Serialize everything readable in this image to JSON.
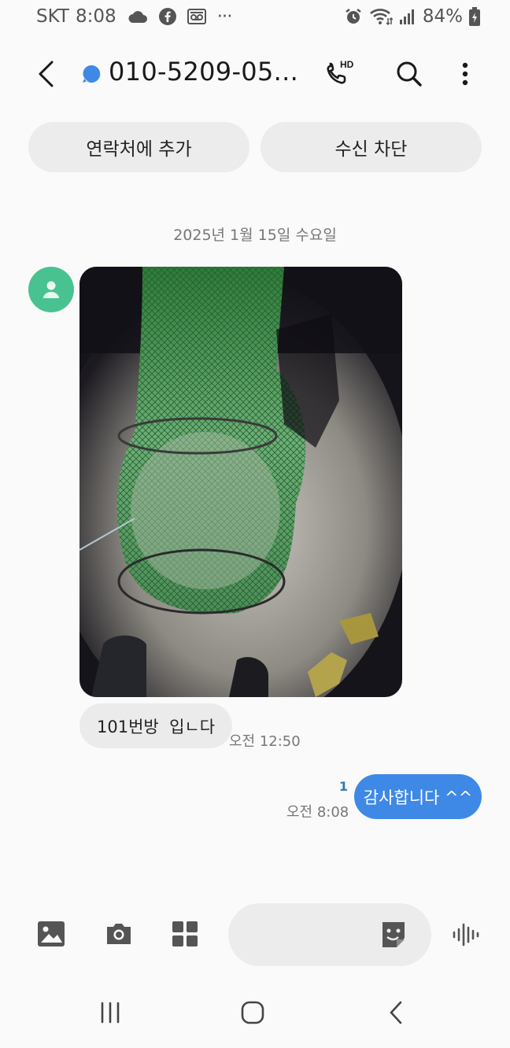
{
  "status_bar": {
    "carrier": "SKT",
    "time": "8:08",
    "more_indicator": "···",
    "battery": "84%",
    "icons_left": [
      "cloud-icon",
      "facebook-icon",
      "voicemail-icon"
    ],
    "icons_right": [
      "alarm-icon",
      "wifi-icon",
      "signal-icon",
      "battery-icon"
    ]
  },
  "header": {
    "title": "010-5209-05...",
    "hd_badge": "HD"
  },
  "actions": {
    "add_contact": "연락처에 추가",
    "block": "수신 차단"
  },
  "conversation": {
    "date": "2025년 1월 15일 수요일",
    "incoming": {
      "text": "101번방  입ㄴ다",
      "time": "오전 12:50"
    },
    "outgoing": {
      "text": "감사합니다 ^^",
      "time": "오전 8:08",
      "unread_count": "1"
    }
  },
  "colors": {
    "accent": "#3f89e6",
    "avatar": "#49c291",
    "chip": "#ececec",
    "background": "#fafafa"
  }
}
